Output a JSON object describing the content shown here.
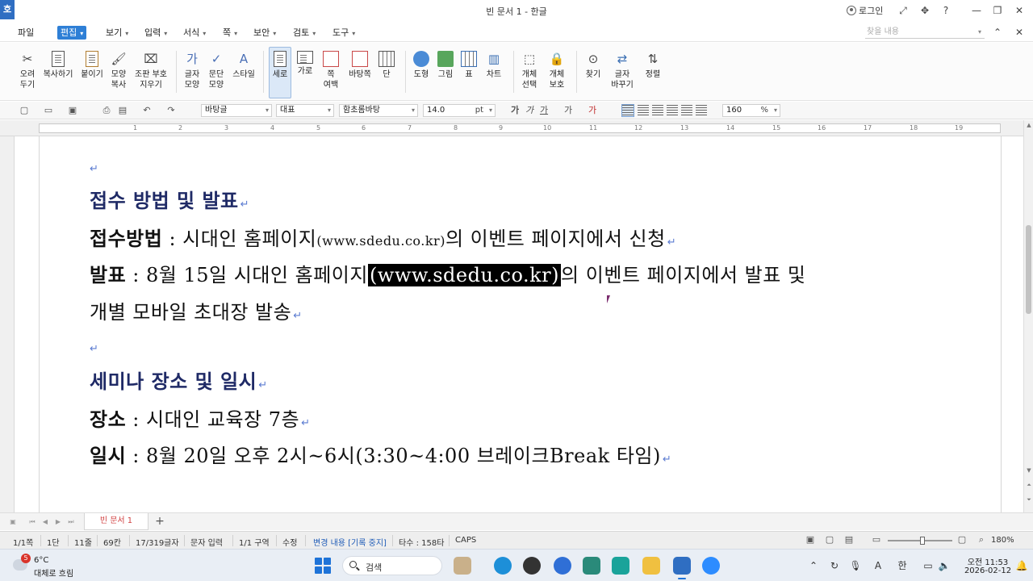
{
  "titlebar": {
    "app_logo": "호",
    "title": "빈 문서 1 - 한글",
    "login_label": "로그인",
    "help_label": "?"
  },
  "menubar": {
    "items": [
      {
        "label": "파일"
      },
      {
        "label": "편집"
      },
      {
        "label": "보기"
      },
      {
        "label": "입력"
      },
      {
        "label": "서식"
      },
      {
        "label": "쪽"
      },
      {
        "label": "보안"
      },
      {
        "label": "검토"
      },
      {
        "label": "도구"
      }
    ],
    "active_index": 1,
    "search_placeholder": "찾을 내용"
  },
  "ribbon": {
    "buttons": [
      {
        "label": "오려\n두기",
        "icon": "scissors-icon"
      },
      {
        "label": "복사하기",
        "icon": "copy-icon"
      },
      {
        "label": "붙이기",
        "icon": "paste-icon"
      },
      {
        "label": "모양\n복사",
        "icon": "format-painter-icon"
      },
      {
        "label": "조판 부호\n지우기",
        "icon": "clear-codes-icon"
      },
      {
        "label": "글자\n모양",
        "icon": "char-shape-icon"
      },
      {
        "label": "문단\n모양",
        "icon": "paragraph-shape-icon"
      },
      {
        "label": "스타일",
        "icon": "style-icon"
      },
      {
        "label": "세로",
        "icon": "portrait-icon"
      },
      {
        "label": "가로",
        "icon": "landscape-icon"
      },
      {
        "label": "쪽\n여백",
        "icon": "page-margin-icon"
      },
      {
        "label": "바탕쪽",
        "icon": "master-page-icon"
      },
      {
        "label": "단",
        "icon": "columns-icon"
      },
      {
        "label": "도형",
        "icon": "shape-icon"
      },
      {
        "label": "그림",
        "icon": "picture-icon"
      },
      {
        "label": "표",
        "icon": "table-icon"
      },
      {
        "label": "차트",
        "icon": "chart-icon"
      },
      {
        "label": "개체\n선택",
        "icon": "object-select-icon"
      },
      {
        "label": "개체\n보호",
        "icon": "object-protect-icon"
      },
      {
        "label": "찾기",
        "icon": "binoculars-icon"
      },
      {
        "label": "글자\n바꾸기",
        "icon": "replace-icon"
      },
      {
        "label": "정렬",
        "icon": "sort-icon"
      }
    ]
  },
  "format_bar": {
    "style_name": "바탕글",
    "representative": "대표",
    "font_name": "함초롬바탕",
    "font_size": "14.0",
    "font_size_unit": "pt",
    "zoom_value": "160",
    "zoom_unit": "%"
  },
  "ruler": {
    "numbers": [
      "1",
      "2",
      "3",
      "4",
      "5",
      "6",
      "7",
      "8",
      "9",
      "10",
      "11",
      "12",
      "13",
      "14",
      "15",
      "16",
      "17",
      "18",
      "19"
    ]
  },
  "document": {
    "heading1": "접수 방법 및 발표",
    "line2_bold": "접수방법",
    "line2_sep": " : ",
    "line2_text": "시대인 홈페이지",
    "line2_url": "(www.sdedu.co.kr)",
    "line2_tail": "의 이벤트 페이지에서 신청",
    "line3_bold": "발표",
    "line3_sep": " : ",
    "line3_text": "8월 15일 시대인 홈페이지",
    "line3_selected": "(www.sdedu.co.kr)",
    "line3_tail": "의 이벤트 페이지에서 발표 및",
    "line4_text": "개별 모바일 초대장 발송",
    "heading2": "세미나 장소 및 일시",
    "line6_bold": "장소",
    "line6_sep": " : ",
    "line6_text": "시대인 교육장 7층",
    "line7_bold": "일시",
    "line7_sep": " : ",
    "line7_text": "8월 20일 오후 2시~6시(3:30~4:00 브레이크Break 타임)",
    "para_mark": "↵"
  },
  "tabbar": {
    "doc_tab": "빈 문서 1",
    "add_label": "+"
  },
  "statusbar": {
    "page": "1/1쪽",
    "column": "1단",
    "line": "11줄",
    "col": "69칸",
    "chars": "17/319글자",
    "input_mode": "문자 입력",
    "section": "1/1 구역",
    "edit_mode": "수정",
    "track_changes": "변경 내용 [기록 중지]",
    "typing_speed": "타수 : 158타",
    "caps": "CAPS",
    "zoom": "180%"
  },
  "taskbar": {
    "weather_temp": "6°C",
    "weather_desc": "대체로 흐림",
    "weather_badge": "5",
    "search_label": "검색",
    "clock_time": "오전 11:53",
    "clock_date": "2026-02-12",
    "ime_label": "한",
    "font_label": "A"
  }
}
